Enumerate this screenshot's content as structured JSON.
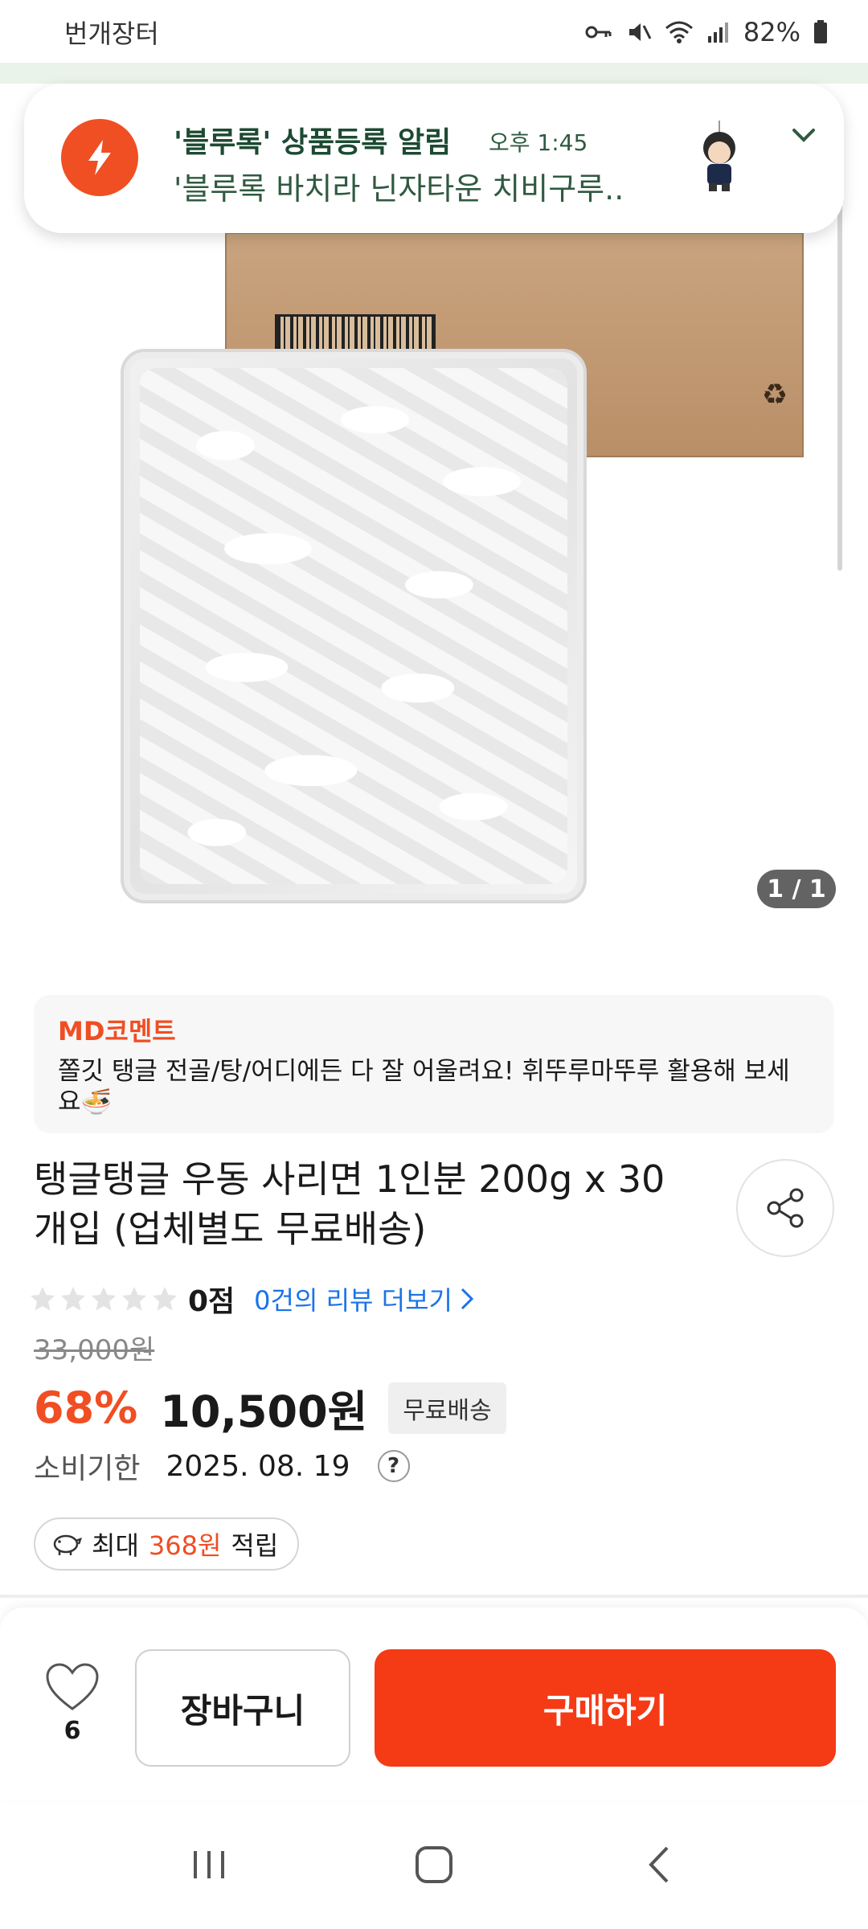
{
  "status_bar": {
    "app_name": "번개장터",
    "battery": "82%"
  },
  "notification": {
    "title": "'블루록' 상품등록 알림",
    "time": "오후 1:45",
    "body": "'블루록 바치라 닌자타운 치비구루.."
  },
  "gallery": {
    "counter": "1 / 1"
  },
  "md_comment": {
    "title": "MD코멘트",
    "text": "쫄깃 탱글 전골/탕/어디에든 다 잘 어울려요! 휘뚜루마뚜루 활용해 보세요🍜"
  },
  "product": {
    "title": "탱글탱글 우동 사리면 1인분 200g x 30개입 (업체별도 무료배송)",
    "rating": 0,
    "score_label": "0점",
    "review_link": "0건의 리뷰 더보기",
    "original_price": "33,000원",
    "discount": "68%",
    "price": "10,500원",
    "shipping_badge": "무료배송",
    "expiry_label": "소비기한",
    "expiry_value": "2025. 08. 19",
    "help_label": "?",
    "points_prefix": "최대",
    "points_amount": "368원",
    "points_suffix": "적립"
  },
  "action_bar": {
    "like_count": "6",
    "cart_label": "장바구니",
    "buy_label": "구매하기"
  },
  "colors": {
    "accent": "#f04e23",
    "buy_button": "#f53a16",
    "link": "#1a73e8"
  }
}
